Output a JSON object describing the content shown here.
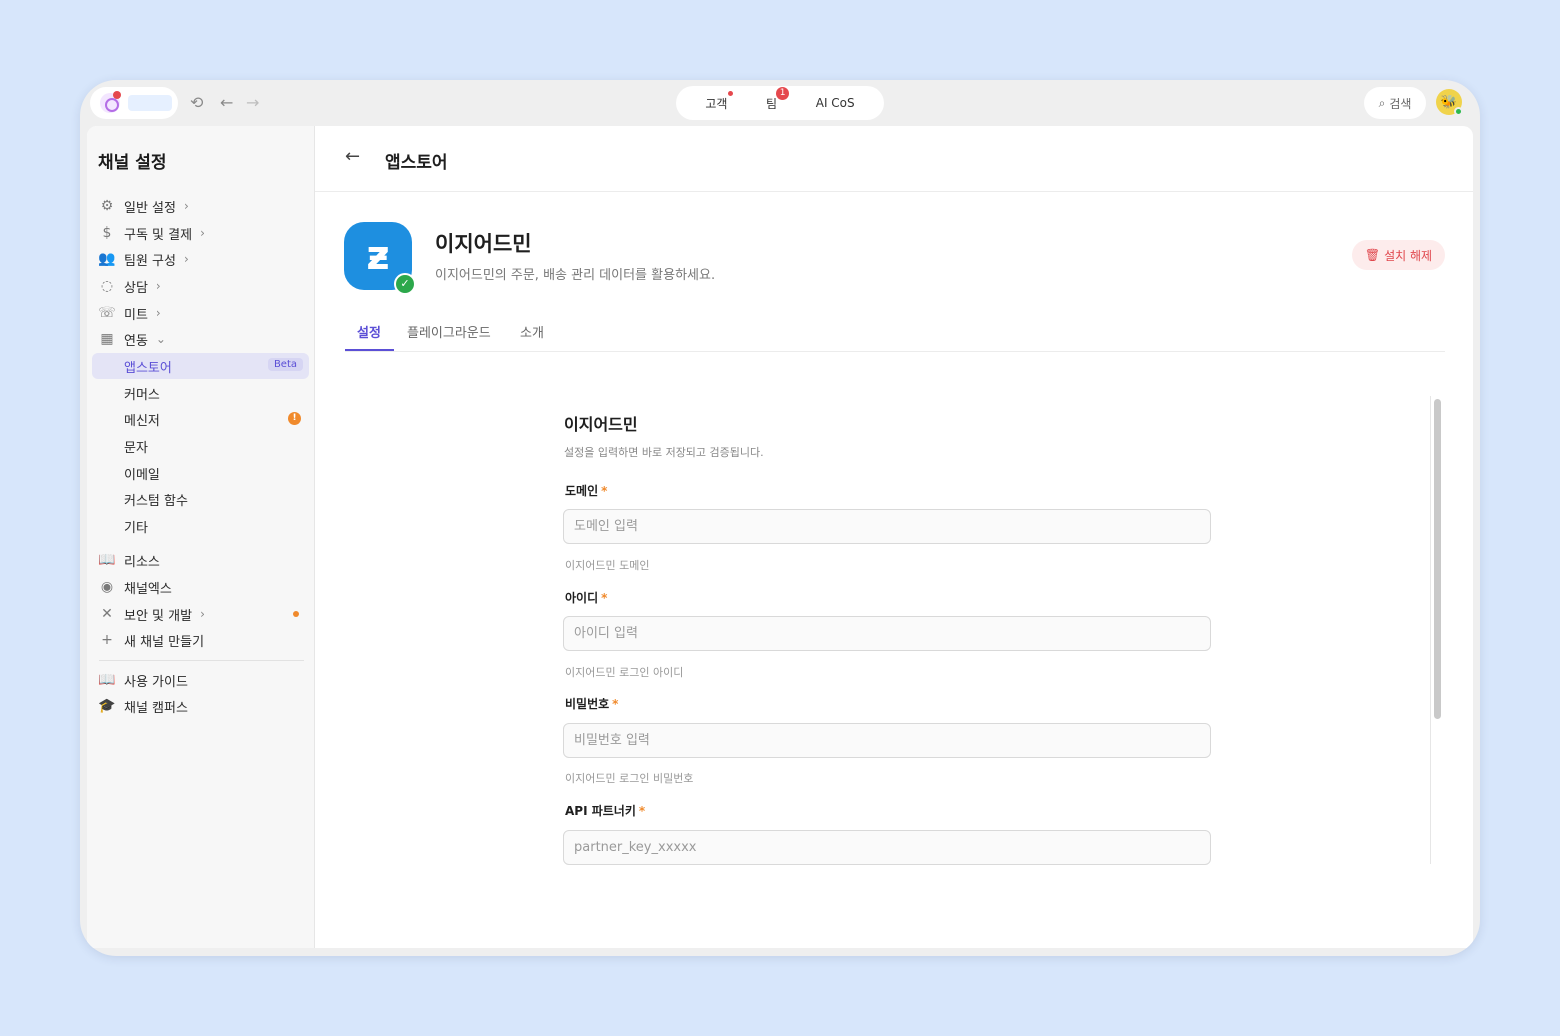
{
  "topbar": {
    "center_tabs": [
      {
        "label": "고객"
      },
      {
        "label": "팀",
        "badge": "1"
      },
      {
        "label": "AI CoS"
      }
    ],
    "search_label": "검색"
  },
  "sidebar": {
    "title": "채널 설정",
    "items": [
      {
        "label": "일반 설정",
        "icon": "gear-icon"
      },
      {
        "label": "구독 및 결제",
        "icon": "dollar-icon"
      },
      {
        "label": "팀원 구성",
        "icon": "people-icon"
      },
      {
        "label": "상담",
        "icon": "chat-icon"
      },
      {
        "label": "미트",
        "icon": "phone-icon"
      },
      {
        "label": "연동",
        "icon": "grid-icon"
      },
      {
        "label": "앱스토어",
        "badge": "Beta"
      },
      {
        "label": "커머스"
      },
      {
        "label": "메신저"
      },
      {
        "label": "문자"
      },
      {
        "label": "이메일"
      },
      {
        "label": "커스텀 함수"
      },
      {
        "label": "기타"
      },
      {
        "label": "리소스",
        "icon": "book-icon"
      },
      {
        "label": "채널엑스",
        "icon": "channelx-icon"
      },
      {
        "label": "보안 및 개발",
        "icon": "tools-icon"
      },
      {
        "label": "새 채널 만들기",
        "icon": "plus-icon"
      },
      {
        "label": "사용 가이드",
        "icon": "book-icon"
      },
      {
        "label": "채널 캠퍼스",
        "icon": "graduation-icon"
      }
    ]
  },
  "header": {
    "title": "앱스토어"
  },
  "app": {
    "name": "이지어드민",
    "description": "이지어드민의 주문, 배송 관리 데이터를 활용하세요.",
    "uninstall_label": "설치 해제"
  },
  "tabs": [
    {
      "label": "설정"
    },
    {
      "label": "플레이그라운드"
    },
    {
      "label": "소개"
    }
  ],
  "form": {
    "title": "이지어드민",
    "subtitle": "설정을 입력하면 바로 저장되고 검증됩니다.",
    "fields": [
      {
        "label": "도메인",
        "placeholder": "도메인 입력",
        "help": "이지어드민 도메인"
      },
      {
        "label": "아이디",
        "placeholder": "아이디 입력",
        "help": "이지어드민 로그인 아이디"
      },
      {
        "label": "비밀번호",
        "placeholder": "비밀번호 입력",
        "help": "이지어드민 로그인 비밀번호"
      },
      {
        "label": "API 파트너키",
        "placeholder": "partner_key_xxxxx",
        "help": ""
      }
    ]
  },
  "colors": {
    "accent": "#5b4fd6",
    "danger": "#e0464c",
    "warning": "#f08a2c"
  }
}
